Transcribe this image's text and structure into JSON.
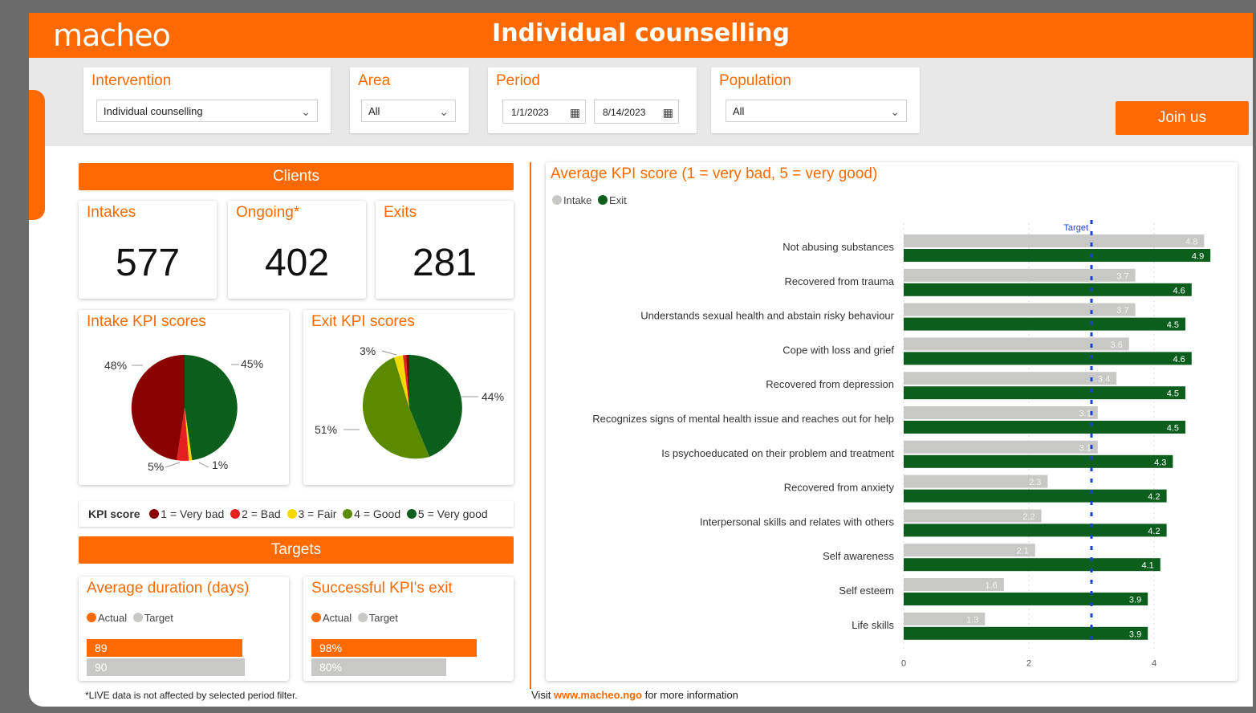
{
  "header": {
    "logo": "macheo",
    "title": "Individual counselling"
  },
  "filters": {
    "intervention": {
      "label": "Intervention",
      "value": "Individual counselling"
    },
    "area": {
      "label": "Area",
      "value": "All"
    },
    "period": {
      "label": "Period",
      "start": "1/1/2023",
      "end": "8/14/2023"
    },
    "population": {
      "label": "Population",
      "value": "All"
    }
  },
  "join_button": "Join us",
  "clients": {
    "header": "Clients",
    "intakes": {
      "label": "Intakes",
      "value": "577"
    },
    "ongoing": {
      "label": "Ongoing*",
      "value": "402"
    },
    "exits": {
      "label": "Exits",
      "value": "281"
    }
  },
  "intake_kpi": {
    "title": "Intake KPI scores",
    "labels": [
      "48%",
      "45%",
      "5%",
      "1%"
    ]
  },
  "exit_kpi": {
    "title": "Exit KPI scores",
    "labels": [
      "3%",
      "44%",
      "51%"
    ]
  },
  "kpi_legend": {
    "title": "KPI score",
    "items": [
      {
        "text": "1 = Very bad",
        "color": "#8b0000"
      },
      {
        "text": "2 = Bad",
        "color": "#e62020"
      },
      {
        "text": "3 = Fair",
        "color": "#f5d800"
      },
      {
        "text": "4 = Good",
        "color": "#5a8a00"
      },
      {
        "text": "5 = Very good",
        "color": "#0b5e1c"
      }
    ]
  },
  "targets": {
    "header": "Targets",
    "duration": {
      "title": "Average duration (days)",
      "legend_actual": "Actual",
      "legend_target": "Target",
      "actual": 89,
      "target": 90,
      "actual_label": "89",
      "target_label": "90"
    },
    "success": {
      "title": "Successful KPI's exit",
      "legend_actual": "Actual",
      "legend_target": "Target",
      "actual": 98,
      "target": 80,
      "actual_label": "98%",
      "target_label": "80%"
    }
  },
  "footnote": "*LIVE data is not affected by selected period filter.",
  "visit": {
    "pre": "Visit ",
    "link": "www.macheo.ngo",
    "post": " for more information"
  },
  "chart_data": {
    "type": "bar",
    "orientation": "horizontal",
    "title": "Average KPI score (1 = very bad, 5 = very good)",
    "legend": [
      "Intake",
      "Exit"
    ],
    "target_label": "Target",
    "target_value": 3,
    "xlim": [
      0,
      5
    ],
    "xticks": [
      0,
      2,
      4
    ],
    "categories": [
      "Not abusing substances",
      "Recovered from trauma",
      "Understands sexual health and abstain risky behaviour",
      "Cope with loss and grief",
      "Recovered from depression",
      "Recognizes signs of mental health issue and reaches out for help",
      "Is psychoeducated on their problem and treatment",
      "Recovered from anxiety",
      "Interpersonal skills and relates with others",
      "Self awareness",
      "Self esteem",
      "Life skills"
    ],
    "series": [
      {
        "name": "Intake",
        "color": "#c8c8c6",
        "values": [
          4.8,
          3.7,
          3.7,
          3.6,
          3.4,
          3.1,
          3.1,
          2.3,
          2.2,
          2.1,
          1.6,
          1.3
        ]
      },
      {
        "name": "Exit",
        "color": "#0b5e1c",
        "values": [
          4.9,
          4.6,
          4.5,
          4.6,
          4.5,
          4.5,
          4.3,
          4.2,
          4.2,
          4.1,
          3.9,
          3.9
        ]
      }
    ]
  },
  "colors": {
    "accent": "#ff6a00",
    "exit": "#0b5e1c",
    "intake": "#c8c8c6",
    "target_bar": "#c8c8c6"
  }
}
